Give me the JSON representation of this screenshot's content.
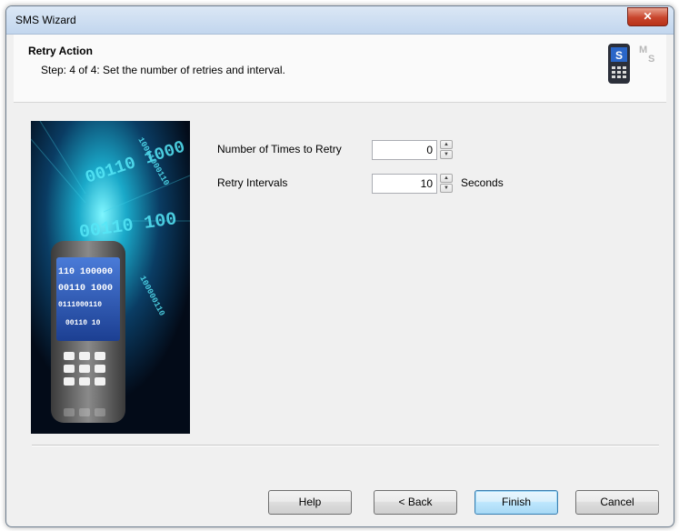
{
  "window": {
    "title": "SMS Wizard",
    "close_glyph": "✕"
  },
  "header": {
    "title": "Retry Action",
    "subtitle": "Step: 4 of 4: Set the number of retries and interval.",
    "logo_icon": "sms-phone-logo-icon"
  },
  "side_image": {
    "icon": "mobile-phone-binary-illustration",
    "screen_lines": [
      "110 100000",
      "00110 1000",
      "0111000110",
      "00110 10"
    ],
    "background_digits": [
      "00110 1000",
      "00110 100",
      "10011000110",
      "100000110"
    ]
  },
  "form": {
    "retries": {
      "label": "Number of Times to Retry",
      "value": "0"
    },
    "interval": {
      "label": "Retry Intervals",
      "value": "10",
      "unit": "Seconds"
    }
  },
  "buttons": {
    "help": "Help",
    "back": "< Back",
    "finish": "Finish",
    "cancel": "Cancel"
  },
  "colors": {
    "title_gradient": "#c2d6ee",
    "close_red": "#c8452c",
    "default_button": "#a7d9f5",
    "image_cyan": "#3ee0f0"
  }
}
